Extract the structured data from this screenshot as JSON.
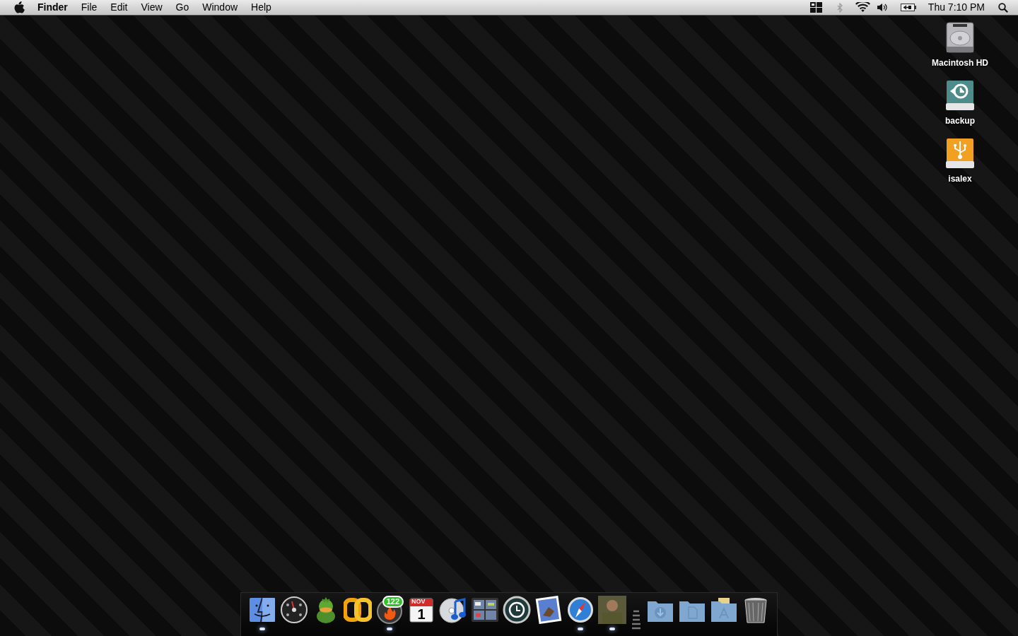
{
  "menu_bar": {
    "app_name": "Finder",
    "menus": [
      "File",
      "Edit",
      "View",
      "Go",
      "Window",
      "Help"
    ],
    "status": {
      "bluetooth_enabled": false,
      "clock": "Thu 7:10 PM"
    }
  },
  "desktop_icons": [
    {
      "label": "Macintosh HD",
      "kind": "hard-disk"
    },
    {
      "label": "backup",
      "kind": "backup-disk"
    },
    {
      "label": "isalex",
      "kind": "usb-disk"
    }
  ],
  "dock": [
    {
      "kind": "finder",
      "running": true
    },
    {
      "kind": "dashboard",
      "running": false
    },
    {
      "kind": "duck",
      "running": false
    },
    {
      "kind": "chain",
      "running": false
    },
    {
      "kind": "flame",
      "running": true,
      "badge": "122"
    },
    {
      "kind": "calendar",
      "running": false,
      "month": "NOV",
      "day": "1"
    },
    {
      "kind": "music",
      "running": false
    },
    {
      "kind": "spaces",
      "running": false
    },
    {
      "kind": "clock",
      "running": false
    },
    {
      "kind": "stamp",
      "running": false
    },
    {
      "kind": "compass",
      "running": true
    },
    {
      "kind": "photo",
      "running": true
    },
    {
      "kind": "separator"
    },
    {
      "kind": "download-folder",
      "running": false
    },
    {
      "kind": "document-folder",
      "running": false
    },
    {
      "kind": "app-folder",
      "running": false
    },
    {
      "kind": "trash",
      "running": false
    }
  ]
}
